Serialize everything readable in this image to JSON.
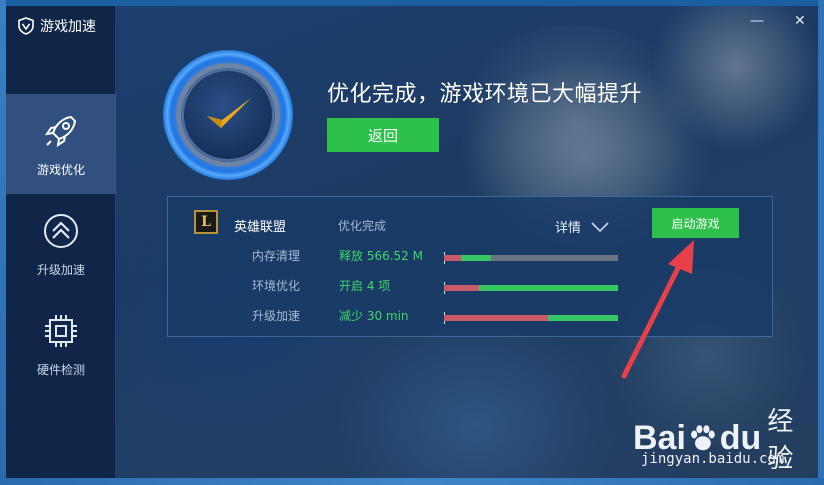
{
  "app": {
    "title": "游戏加速"
  },
  "window_controls": {
    "minimize": "—",
    "close": "✕"
  },
  "sidebar": {
    "items": [
      {
        "label": "游戏优化",
        "icon": "rocket-icon",
        "active": true
      },
      {
        "label": "升级加速",
        "icon": "double-chevron-up-icon",
        "active": false
      },
      {
        "label": "硬件检测",
        "icon": "chip-icon",
        "active": false
      }
    ]
  },
  "hero": {
    "title": "优化完成，游戏环境已大幅提升",
    "back_label": "返回"
  },
  "game": {
    "logo_letter": "L",
    "name": "英雄联盟",
    "status": "优化完成",
    "details_label": "详情",
    "launch_label": "启动游戏",
    "rows": [
      {
        "label": "内存清理",
        "value": "释放 566.52 M",
        "red": 0.1,
        "green": 0.17
      },
      {
        "label": "环境优化",
        "value": "开启 4 项",
        "red": 0.2,
        "green": 0.8
      },
      {
        "label": "升级加速",
        "value": "减少 30 min",
        "red": 0.6,
        "green": 0.4
      }
    ]
  },
  "watermark": {
    "brand_a": "Bai",
    "brand_b": "du",
    "brand_cn": "经验",
    "url": "jingyan.baidu.com"
  },
  "colors": {
    "accent_green": "#2dc04b",
    "value_green": "#3fd667",
    "bar_red": "#c85a6a",
    "annotation_red": "#e8404a"
  }
}
